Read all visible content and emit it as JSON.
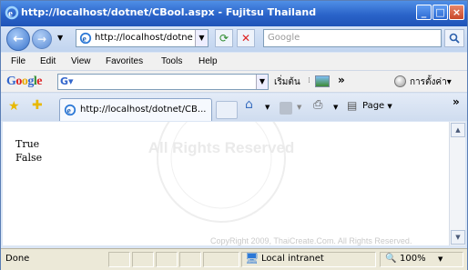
{
  "window": {
    "title": "http://localhost/dotnet/CBool.aspx - Fujitsu Thailand"
  },
  "nav": {
    "address": "http://localhost/dotne",
    "search_placeholder": "Google"
  },
  "menu": [
    "File",
    "Edit",
    "View",
    "Favorites",
    "Tools",
    "Help"
  ],
  "google_toolbar": {
    "logo": "Google",
    "start": "เริ่มต้น",
    "settings": "การตั้งค่า"
  },
  "tab": {
    "title": "http://localhost/dotnet/CB..."
  },
  "tools": {
    "page": "Page"
  },
  "content": {
    "lines": [
      "True",
      "False"
    ],
    "watermark": "All Rights Reserved",
    "copyright": "CopyRight 2009, ThaiCreate.Com. All Rights Reserved."
  },
  "status": {
    "text": "Done",
    "zone": "Local intranet",
    "zoom": "100%"
  }
}
